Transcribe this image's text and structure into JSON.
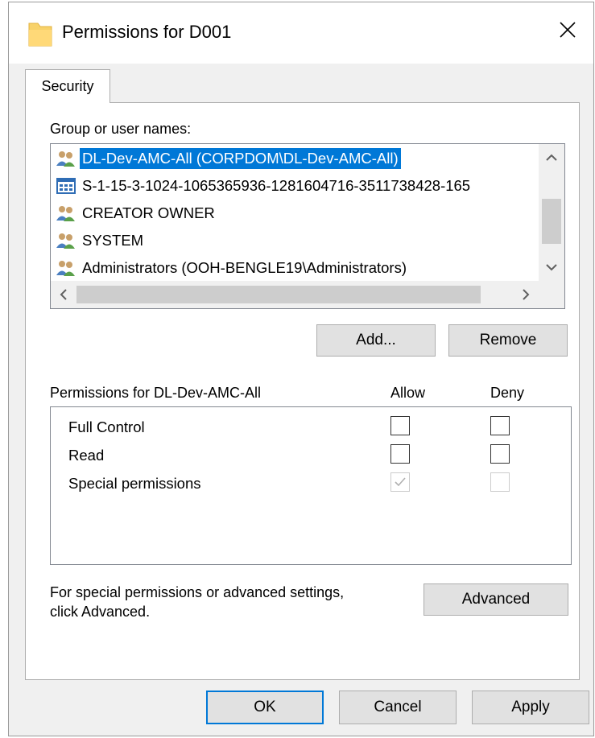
{
  "window": {
    "title": "Permissions for D001",
    "title_icon": "folder-icon",
    "close_icon": "close-icon"
  },
  "tabs": [
    {
      "label": "Security",
      "active": true
    }
  ],
  "group_list": {
    "label": "Group or user names:",
    "items": [
      {
        "icon": "group-users-icon",
        "text": "DL-Dev-AMC-All (CORPDOM\\DL-Dev-AMC-All)",
        "selected": true
      },
      {
        "icon": "app-package-icon",
        "text": "S-1-15-3-1024-1065365936-1281604716-3511738428-165",
        "selected": false
      },
      {
        "icon": "group-users-icon",
        "text": "CREATOR OWNER",
        "selected": false
      },
      {
        "icon": "group-users-icon",
        "text": "SYSTEM",
        "selected": false
      },
      {
        "icon": "group-users-icon",
        "text": "Administrators (OOH-BENGLE19\\Administrators)",
        "selected": false
      }
    ],
    "scroll_up": "^",
    "scroll_down": "v",
    "scroll_left": "<",
    "scroll_right": ">"
  },
  "buttons": {
    "add": "Add...",
    "remove": "Remove",
    "advanced": "Advanced",
    "ok": "OK",
    "cancel": "Cancel",
    "apply": "Apply"
  },
  "permissions": {
    "label": "Permissions for DL-Dev-AMC-All",
    "allow_header": "Allow",
    "deny_header": "Deny",
    "rows": [
      {
        "name": "Full Control",
        "allow": false,
        "deny": false,
        "enabled": true
      },
      {
        "name": "Read",
        "allow": false,
        "deny": false,
        "enabled": true
      },
      {
        "name": "Special permissions",
        "allow": true,
        "deny": false,
        "enabled": false
      }
    ]
  },
  "advanced_note": {
    "line1": "For special permissions or advanced settings,",
    "line2": "click Advanced."
  },
  "colors": {
    "selection": "#0078d7",
    "dialog_bg": "#f0f0f0",
    "button_bg": "#e1e1e1"
  }
}
